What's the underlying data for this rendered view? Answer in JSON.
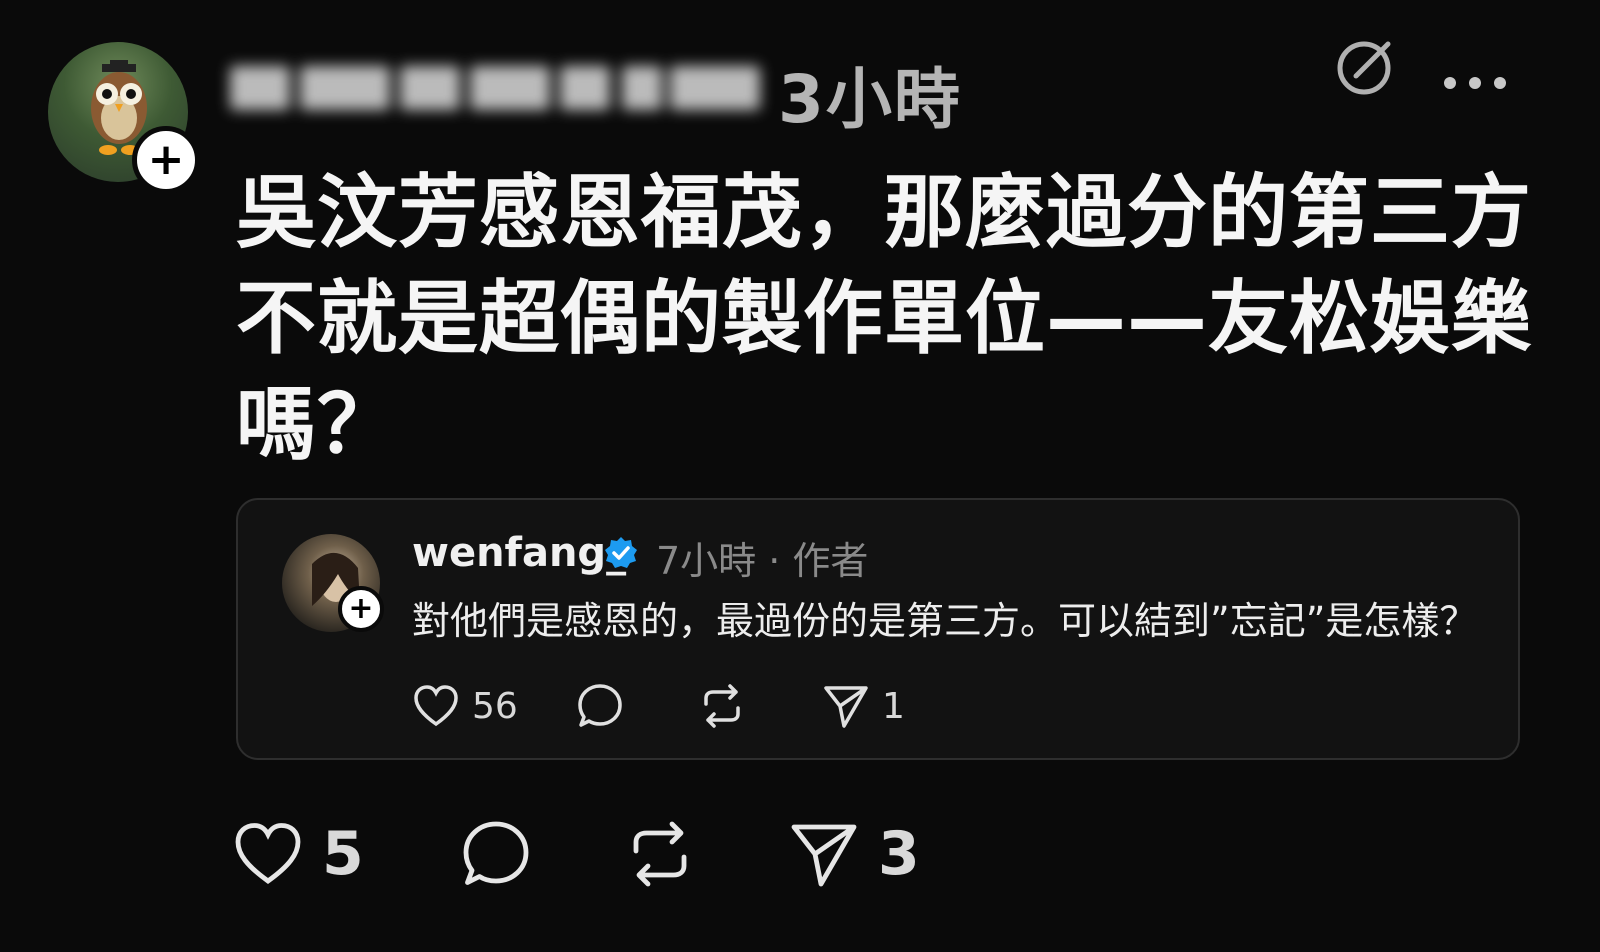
{
  "post": {
    "timestamp": "3小時",
    "text": "吳汶芳感恩福茂，那麼過分的第三方不就是超偶的製作單位——友松娛樂嗎？",
    "actions": {
      "likes": "5",
      "shares": "3"
    }
  },
  "quote": {
    "username": "wenfang_",
    "meta": "7小時 · 作者",
    "text": "對他們是感恩的，最過份的是第三方。可以結到”忘記”是怎樣？",
    "actions": {
      "likes": "56",
      "shares": "1"
    }
  },
  "icons": {
    "follow": "+",
    "verified_color": "#1d9bf0"
  }
}
